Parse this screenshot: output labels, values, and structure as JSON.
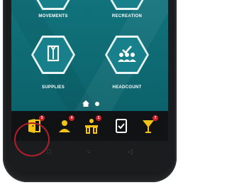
{
  "tiles": [
    {
      "label": "MOVEMENTS",
      "icon": "movements-icon"
    },
    {
      "label": "RECREATION",
      "icon": "dumbbell-icon"
    },
    {
      "label": "SUPPLIES",
      "icon": "supplies-icon"
    },
    {
      "label": "HEADCOUNT",
      "icon": "headcount-icon"
    }
  ],
  "bottom_nav": [
    {
      "icon": "door-icon",
      "badge": "3",
      "highlighted": true
    },
    {
      "icon": "person-icon",
      "badge": "4"
    },
    {
      "icon": "desk-icon",
      "badge": "1"
    },
    {
      "icon": "checklist-icon",
      "badge": ""
    },
    {
      "icon": "drink-icon",
      "badge": "7"
    }
  ],
  "system_nav": {
    "recents": "□",
    "home": "○",
    "back": "◁"
  },
  "colors": {
    "screen_bg": "#12747d",
    "tile_hex": "#e9f4f5",
    "nav_accent": "#f3c318",
    "badge": "#d11f2a",
    "highlight_ring": "#b1202a"
  }
}
